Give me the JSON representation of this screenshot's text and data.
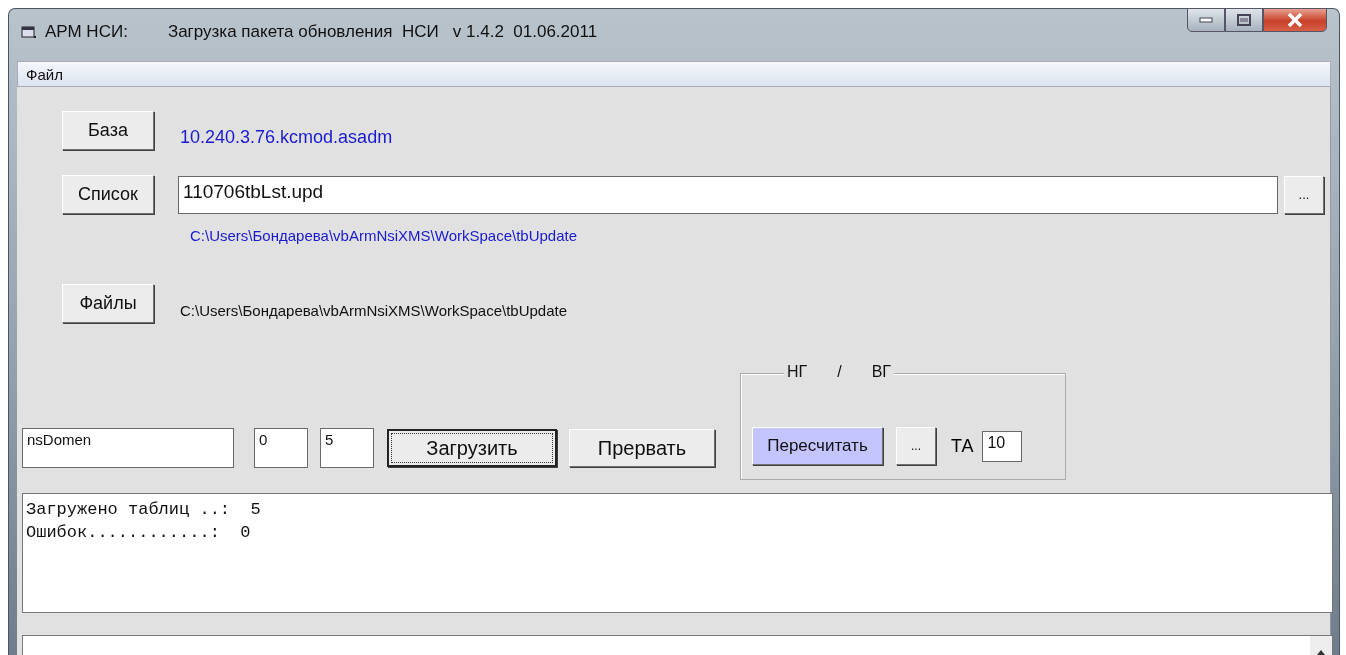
{
  "window": {
    "title_app": "АРМ НСИ:",
    "title": "Загрузка пакета обновления  НСИ   v 1.4.2  01.06.2011"
  },
  "menu": [
    "Файл"
  ],
  "base": {
    "button": "База",
    "value": "10.240.3.76.kcmod.asadm"
  },
  "list": {
    "button": "Список",
    "value": "110706tbLst.upd",
    "browse": "...",
    "path": "C:\\Users\\Бондарева\\vbArmNsiXMS\\WorkSpace\\tbUpdate"
  },
  "files": {
    "button": "Файлы",
    "path": "C:\\Users\\Бондарева\\vbArmNsiXMS\\WorkSpace\\tbUpdate"
  },
  "controls": {
    "domain": "nsDomen",
    "from": "0",
    "to": "5",
    "load": "Загрузить",
    "stop": "Прервать"
  },
  "group": {
    "legend_left": "НГ",
    "legend_sep": "/",
    "legend_right": "ВГ",
    "recalc": "Пересчитать",
    "more": "...",
    "ta_label": "ТА",
    "ta_value": "10"
  },
  "log": [
    "Загружено таблиц ..:  5",
    "Ошибок............:  0"
  ]
}
